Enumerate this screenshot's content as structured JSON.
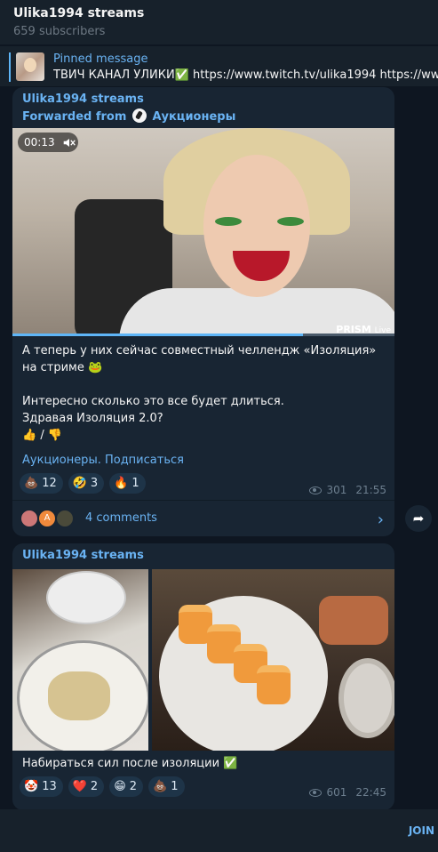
{
  "header": {
    "title": "Ulika1994 streams",
    "subscribers": "659 subscribers"
  },
  "pinned": {
    "label": "Pinned message",
    "text": "ТВИЧ КАНАЛ УЛИКИ✅ https://www.twitch.tv/ulika1994 https://www.tw"
  },
  "post1": {
    "channel": "Ulika1994 streams",
    "forwarded_prefix": "Forwarded from",
    "forwarded_name": "Аукционеры",
    "video_time": "00:13",
    "video_progress": 0.76,
    "watermark": "PRISM",
    "watermark_sub": "Live",
    "text_line1": "А теперь у них сейчас совместный челлендж «Изоляция» на стриме 🐸",
    "text_line2": "Интересно сколько это все будет длиться.",
    "text_line3": "Здравая Изоляция 2.0?",
    "text_line4": "👍 / 👎",
    "link": "Аукционеры. Подписаться",
    "reactions": [
      {
        "emoji": "💩",
        "count": "12"
      },
      {
        "emoji": "🤣",
        "count": "3"
      },
      {
        "emoji": "🔥",
        "count": "1"
      }
    ],
    "views": "301",
    "time": "21:55",
    "comments": "4 comments",
    "avatar2_letter": "A"
  },
  "post2": {
    "channel": "Ulika1994 streams",
    "caption": "Набираться сил после изоляции ✅",
    "reactions": [
      {
        "emoji": "🤡",
        "count": "13"
      },
      {
        "emoji": "❤️",
        "count": "2"
      },
      {
        "emoji": "😁",
        "count": "2"
      },
      {
        "emoji": "💩",
        "count": "1"
      }
    ],
    "views": "601",
    "time": "22:45"
  },
  "bottom": {
    "join": "JOIN"
  },
  "colors": {
    "accent": "#6ab3f3",
    "bg": "#0e1621",
    "bubble": "#182533"
  }
}
